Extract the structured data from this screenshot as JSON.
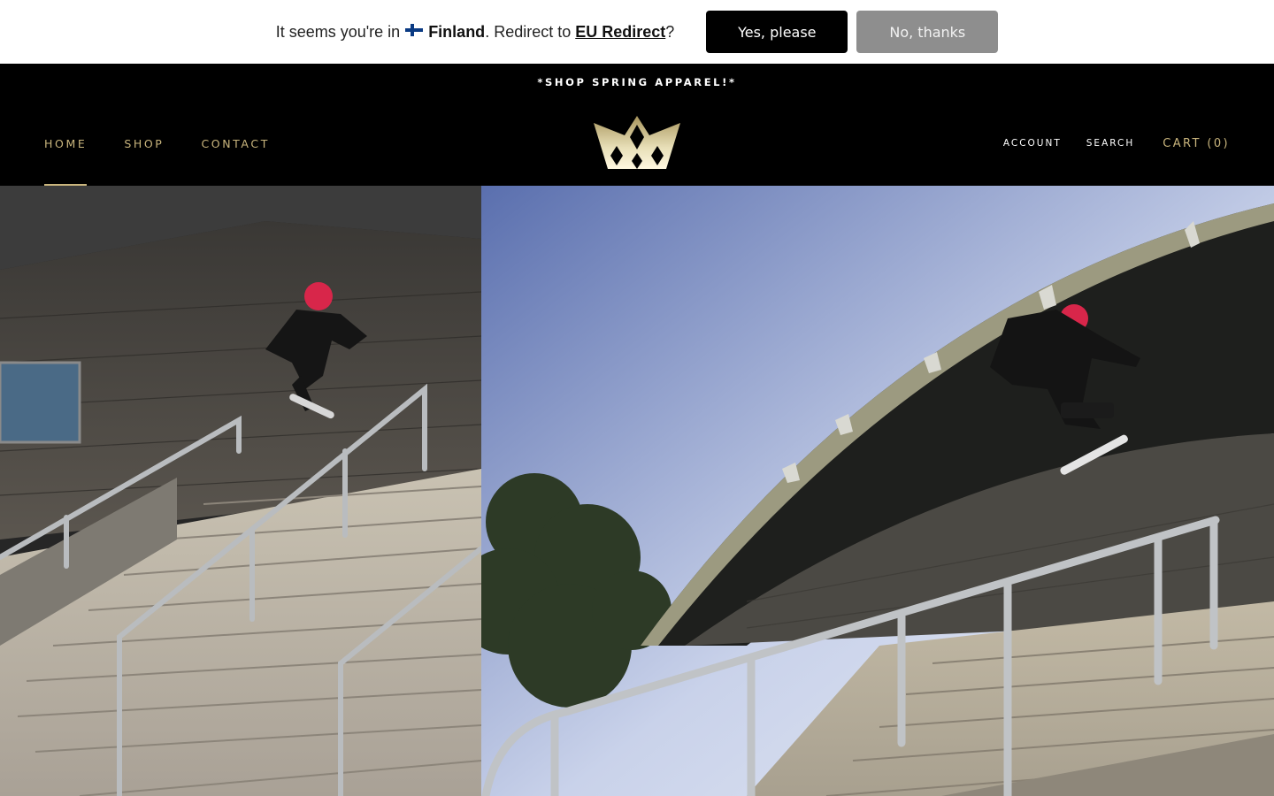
{
  "geo_bar": {
    "prefix": "It seems you're in",
    "country": "Finland",
    "middle": ". Redirect to",
    "target": "EU Redirect",
    "suffix": "?",
    "yes_label": "Yes, please",
    "no_label": "No, thanks",
    "flag_icon": "finland-flag-icon"
  },
  "announcement": {
    "text": "*SHOP SPRING APPAREL!*"
  },
  "nav": {
    "left": [
      {
        "label": "HOME",
        "active": true
      },
      {
        "label": "SHOP",
        "active": false
      },
      {
        "label": "CONTACT",
        "active": false
      }
    ],
    "account_label": "ACCOUNT",
    "search_label": "SEARCH",
    "cart_label": "CART (0)",
    "logo_icon": "crown-logo-icon"
  },
  "colors": {
    "gold": "#c9b57d",
    "black": "#000000",
    "button_gray": "#8e8e8e"
  },
  "hero": {
    "images": [
      "skater-handrail-photo-left",
      "skater-handrail-photo-right"
    ]
  }
}
